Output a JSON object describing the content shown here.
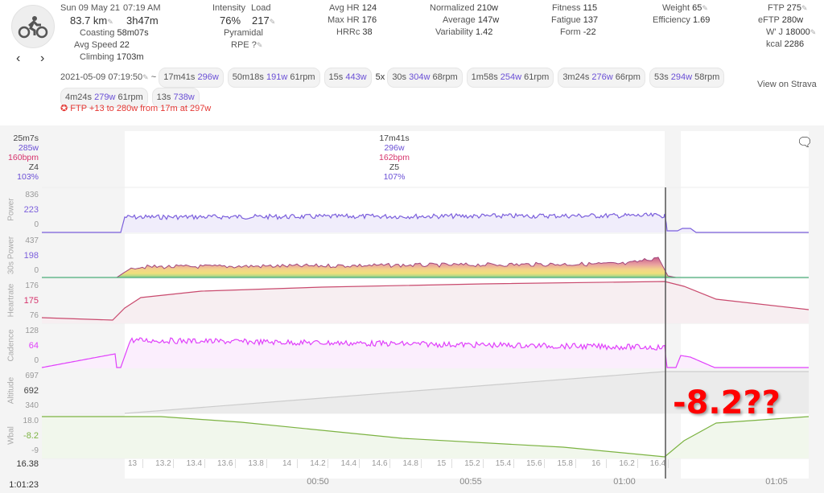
{
  "activity": {
    "date": "Sun 09 May 21",
    "time": "07:19 AM",
    "distance": "83.7 km",
    "duration": "3h47m",
    "coasting_label": "Coasting",
    "coasting": "58m07s",
    "avg_speed_label": "Avg Speed",
    "avg_speed": "22",
    "climbing_label": "Climbing",
    "climbing": "1703m",
    "intensity_label": "Intensity",
    "intensity": "76%",
    "load_label": "Load",
    "load": "217",
    "pyramidal": "Pyramidal",
    "rpe_label": "RPE",
    "rpe": "?",
    "avg_hr_label": "Avg HR",
    "avg_hr": "124",
    "max_hr_label": "Max HR",
    "max_hr": "176",
    "hrrc_label": "HRRc",
    "hrrc": "38",
    "normalized_label": "Normalized",
    "normalized": "210w",
    "average_label": "Average",
    "average": "147w",
    "variability_label": "Variability",
    "variability": "1.42",
    "fitness_label": "Fitness",
    "fitness": "115",
    "fatigue_label": "Fatigue",
    "fatigue": "137",
    "form_label": "Form",
    "form": "-22",
    "weight_label": "Weight",
    "weight": "65",
    "efficiency_label": "Efficiency",
    "efficiency": "1.69",
    "ftp_label": "FTP",
    "ftp": "275",
    "eftp_label": "eFTP",
    "eftp": "280w",
    "wprime_label": "W' J",
    "wprime": "18000",
    "kcal_label": "kcal",
    "kcal": "2286",
    "timestamp": "2021-05-09 07:19:50",
    "tilde": "~",
    "view_strava": "View on Strava",
    "ftp_notice": "FTP +13 to 280w from 17m at 297w"
  },
  "intervals": [
    {
      "dur": "17m41s",
      "watts": "296w",
      "rpm": ""
    },
    {
      "dur": "50m18s",
      "watts": "191w",
      "rpm": "61rpm"
    },
    {
      "dur": "15s",
      "watts": "443w",
      "rpm": ""
    },
    {
      "prefix": "5x",
      "dur": "30s",
      "watts": "304w",
      "rpm": "68rpm"
    },
    {
      "dur": "1m58s",
      "watts": "254w",
      "rpm": "61rpm"
    },
    {
      "dur": "3m24s",
      "watts": "276w",
      "rpm": "66rpm"
    },
    {
      "dur": "53s",
      "watts": "294w",
      "rpm": "58rpm"
    },
    {
      "dur": "4m24s",
      "watts": "279w",
      "rpm": "61rpm"
    },
    {
      "dur": "13s",
      "watts": "738w",
      "rpm": ""
    }
  ],
  "hover_left": {
    "dur": "25m7s",
    "watts": "285w",
    "hr": "160bpm",
    "zone": "Z4",
    "pct": "103%"
  },
  "selection": {
    "dur": "17m41s",
    "watts": "296w",
    "hr": "162bpm",
    "zone": "Z5",
    "pct": "107%"
  },
  "rows": [
    {
      "name": "Power",
      "max": "836",
      "val": "223",
      "min": "0",
      "color": "#7b5fdc"
    },
    {
      "name": "30s Power",
      "max": "437",
      "val": "198",
      "min": "0",
      "color": "#7b5fdc"
    },
    {
      "name": "Heartrate",
      "max": "176",
      "val": "175",
      "min": "76",
      "color": "#d6336c"
    },
    {
      "name": "Cadence",
      "max": "128",
      "val": "64",
      "min": "0",
      "color": "#e040fb"
    },
    {
      "name": "Altitude",
      "max": "697",
      "val": "692",
      "min": "340",
      "color": "#444444"
    },
    {
      "name": "Wbal",
      "max": "18.0",
      "val": "-8.2",
      "min": "-9",
      "color": "#7cb342"
    }
  ],
  "distance_cursor": "16.38",
  "time_cursor": "1:01:23",
  "distance_ticks": [
    "13",
    "13.2",
    "13.4",
    "13.6",
    "13.8",
    "14",
    "14.2",
    "14.4",
    "14.6",
    "14.8",
    "15",
    "15.2",
    "15.4",
    "15.6",
    "15.8",
    "16",
    "16.2",
    "16.4"
  ],
  "time_ticks": [
    "00:50",
    "00:55",
    "01:00",
    "01:05"
  ],
  "annotation": "-8.2??"
}
